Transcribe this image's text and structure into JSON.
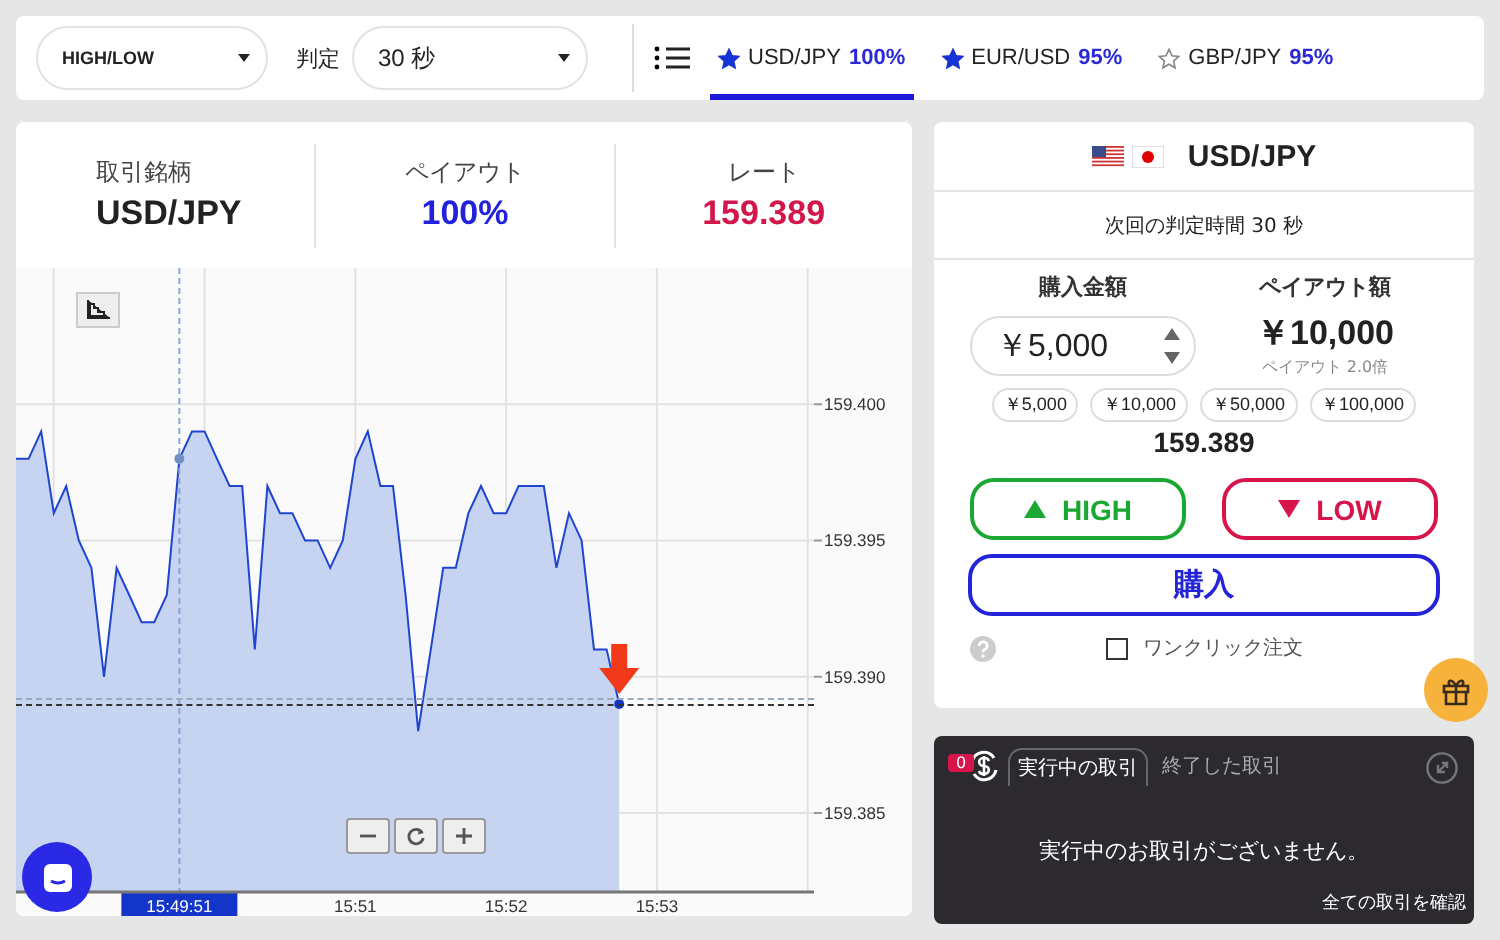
{
  "toolbar": {
    "trade_type": "HIGH/LOW",
    "judge_label": "判定",
    "judge_value": "30 秒",
    "tabs": [
      {
        "pair": "USD/JPY",
        "payout": "100%",
        "favorite": true,
        "selected": true
      },
      {
        "pair": "EUR/USD",
        "payout": "95%",
        "favorite": true,
        "selected": false
      },
      {
        "pair": "GBP/JPY",
        "payout": "95%",
        "favorite": false,
        "selected": false
      }
    ]
  },
  "summary": [
    {
      "label": "取引銘柄",
      "value": "USD/JPY",
      "kind": "plain"
    },
    {
      "label": "ペイアウト",
      "value": "100%",
      "kind": "payout"
    },
    {
      "label": "レート",
      "value": "159.389",
      "kind": "rate"
    }
  ],
  "chart_data": {
    "type": "area",
    "grid": true,
    "ylim": [
      159.3821,
      159.405
    ],
    "yticks": [
      {
        "value": 159.385,
        "label": "159.385"
      },
      {
        "value": 159.39,
        "label": "159.390"
      },
      {
        "value": 159.395,
        "label": "159.395"
      },
      {
        "value": 159.4,
        "label": "159.400"
      }
    ],
    "categories": [
      null,
      null,
      null,
      null,
      null,
      null,
      null,
      null,
      null,
      null,
      null,
      null,
      null,
      "15:49:51",
      null,
      null,
      null,
      null,
      null,
      null,
      null,
      null,
      null,
      null,
      null,
      null,
      null,
      "15:51",
      null,
      null,
      null,
      null,
      null,
      null,
      null,
      null,
      null,
      null,
      null,
      "15:52",
      null,
      null,
      null,
      null,
      null,
      null,
      null,
      null,
      null,
      null,
      null,
      "15:53"
    ],
    "series": [
      {
        "color": "#1f45d0",
        "values": [
          159.398,
          159.398,
          159.399,
          159.396,
          159.397,
          159.395,
          159.394,
          159.39,
          159.394,
          159.393,
          159.392,
          159.392,
          159.393,
          159.398,
          159.399,
          159.399,
          159.398,
          159.397,
          159.397,
          159.391,
          159.397,
          159.396,
          159.396,
          159.395,
          159.395,
          159.394,
          159.395,
          159.398,
          159.399,
          159.397,
          159.397,
          159.393,
          159.388,
          159.391,
          159.394,
          159.394,
          159.396,
          159.397,
          159.396,
          159.396,
          159.397,
          159.397,
          159.397,
          159.394,
          159.396,
          159.395,
          159.391,
          159.391,
          159.389,
          null,
          null,
          null
        ]
      }
    ]
  },
  "chart": {
    "crosshair": true
  },
  "order": {
    "pair": "USD/JPY",
    "next_judge": "次回の判定時間 30 秒",
    "amount_label": "購入金額",
    "amount": "￥5,000",
    "payout_label": "ペイアウト額",
    "payout_amount": "￥10,000",
    "payout_ratio": "ペイアウト 2.0倍",
    "presets": [
      "￥5,000",
      "￥10,000",
      "￥50,000",
      "￥100,000"
    ],
    "rate": "159.389",
    "high": "HIGH",
    "low": "LOW",
    "buy": "購入",
    "one_click": {
      "label": "ワンクリック注文",
      "checked": false
    }
  },
  "trades": {
    "count": "0",
    "tabs": [
      {
        "label": "実行中の取引",
        "selected": true
      },
      {
        "label": "終了した取引",
        "selected": false
      }
    ],
    "empty": "実行中のお取引がございません。",
    "all_link": "全ての取引を確認"
  }
}
